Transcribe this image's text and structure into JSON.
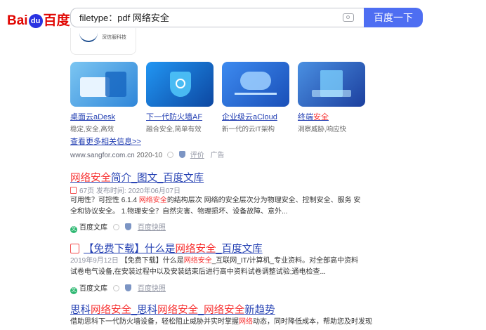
{
  "header": {
    "logo_left": "Bai",
    "logo_paw": "du",
    "logo_right": "百度",
    "search_value": "filetype：pdf 网络安全",
    "search_button": "百度一下"
  },
  "brand_card": {
    "logo_text": "深信服科技"
  },
  "products": [
    {
      "title_pre": "桌面云aDesk",
      "title_hl": "",
      "desc": "稳定,安全,高效",
      "img_bg": "#5aa9e6"
    },
    {
      "title_pre": "下一代防火墙AF",
      "title_hl": "",
      "desc": "融合安全,简单有效",
      "img_bg": "#1f7fd6"
    },
    {
      "title_pre": "企业级云aCloud",
      "title_hl": "",
      "desc": "新一代的云IT架构",
      "img_bg": "#2c6fd8"
    },
    {
      "title_pre": "终端",
      "title_hl": "安全",
      "desc": "洞察威胁,响应快",
      "img_bg": "#3a7de0"
    }
  ],
  "more_link": "查看更多相关信息>>",
  "ad_source": {
    "url": "www.sangfor.com.cn",
    "date": "2020-10",
    "rating": "评价",
    "ad": "广告"
  },
  "results": [
    {
      "title_hl1": "网络安全",
      "title_rest": "简介_图文_百度文库",
      "meta": "67页 发布时间: 2020年06月07日",
      "snippet_a": "可用性？可控性 6.1.4 ",
      "snippet_hl": "网络安全",
      "snippet_b": "的结构层次 网络的安全层次分为物理安全、控制安全、服务 安全和协议安全。 1.物理安全？自然灾害、物理损坏、设备故障、意外...",
      "source": "百度文库",
      "snapshot": "百度快照"
    },
    {
      "title_pre": "【免费下载】什么是",
      "title_hl1": "网络安全",
      "title_rest": "_百度文库",
      "date": "2019年9月12日",
      "snippet_a": "【免费下载】什么是",
      "snippet_hl": "网络安全",
      "snippet_b": "_互联网_IT/计算机_专业资料。对全部高中资料试卷电气设备,在安装过程中以及安装结束后进行高中资料试卷调整试验;通电检查...",
      "source": "百度文库",
      "snapshot": "百度快照"
    },
    {
      "title_pre": "思科",
      "title_hl1": "网络安全",
      "title_mid": "_思科",
      "title_hl2": "网络安全",
      "title_sep": "_",
      "title_hl3": "网络安全",
      "title_rest": "新趋势",
      "snippet_a": "借助思科下一代防火墙设备，轻松阻止威胁并实时掌握",
      "snippet_hl": "网络",
      "snippet_b": "动态，同时降低成本，帮助您及时发现"
    }
  ]
}
